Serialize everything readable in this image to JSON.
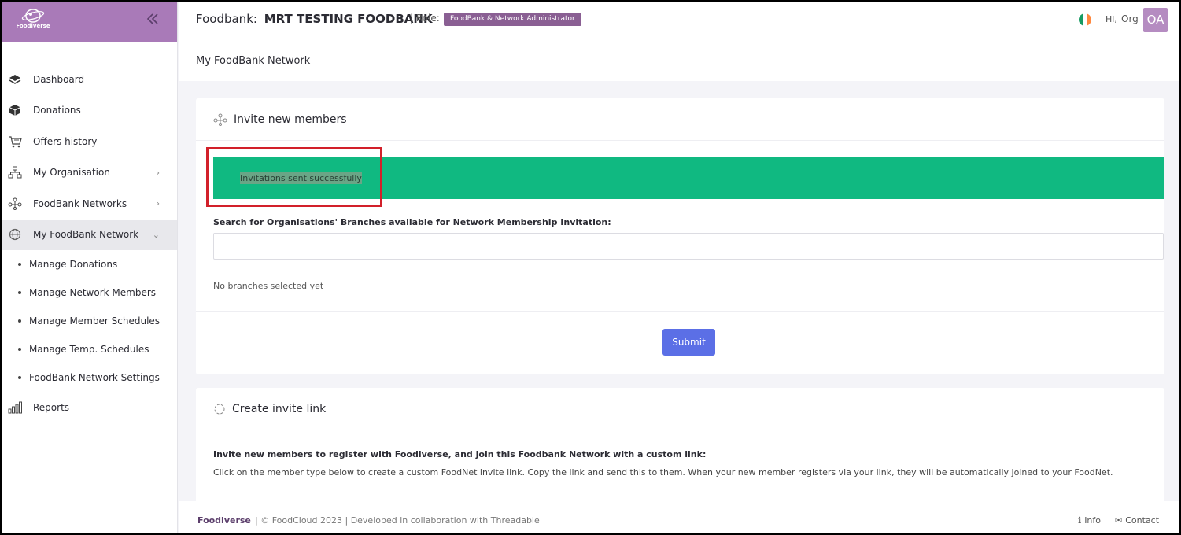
{
  "brand": {
    "logo_text": "Foodiverse"
  },
  "sidebar": {
    "items": [
      {
        "label": "Dashboard",
        "icon": "layers-icon"
      },
      {
        "label": "Donations",
        "icon": "box-icon"
      },
      {
        "label": "Offers history",
        "icon": "cart-icon"
      },
      {
        "label": "My Organisation",
        "icon": "org-chart-icon"
      },
      {
        "label": "FoodBank Networks",
        "icon": "network-icon"
      },
      {
        "label": "My FoodBank Network",
        "icon": "globe-icon"
      }
    ],
    "subitems": [
      {
        "label": "Manage Donations"
      },
      {
        "label": "Manage Network Members"
      },
      {
        "label": "Manage Member Schedules"
      },
      {
        "label": "Manage Temp. Schedules"
      },
      {
        "label": "FoodBank Network Settings"
      }
    ],
    "reports": {
      "label": "Reports",
      "icon": "bar-chart-icon"
    }
  },
  "header": {
    "foodbank_label": "Foodbank:",
    "foodbank_name": "MRT TESTING FOODBANK",
    "role_label": "| Role:",
    "role_badge": "FoodBank & Network Administrator",
    "hi": "Hi,",
    "user_name": "Org",
    "avatar_initials": "OA"
  },
  "page": {
    "title": "My FoodBank Network"
  },
  "invite_card": {
    "title": "Invite new members",
    "alert": "Invitations sent successfully",
    "search_label": "Search for Organisations' Branches available for Network Membership Invitation:",
    "search_placeholder": "",
    "no_branches": "No branches selected yet",
    "submit": "Submit"
  },
  "link_card": {
    "title": "Create invite link",
    "bold_text": "Invite new members to register with Foodiverse, and join this Foodbank Network with a custom link:",
    "body_text": "Click on the member type below to create a custom FoodNet invite link. Copy the link and send this to them. When your new member registers via your link, they will be automatically joined to your FoodNet."
  },
  "footer": {
    "brand": "Foodiverse",
    "copy": "|  © FoodCloud 2023  |  Developed in collaboration with Threadable",
    "info": "Info",
    "contact": "Contact"
  },
  "colors": {
    "brand_purple": "#a97ab8",
    "role_badge": "#8a5f93",
    "success": "#10b981",
    "submit": "#5b6fe6",
    "highlight": "#d2202a"
  }
}
